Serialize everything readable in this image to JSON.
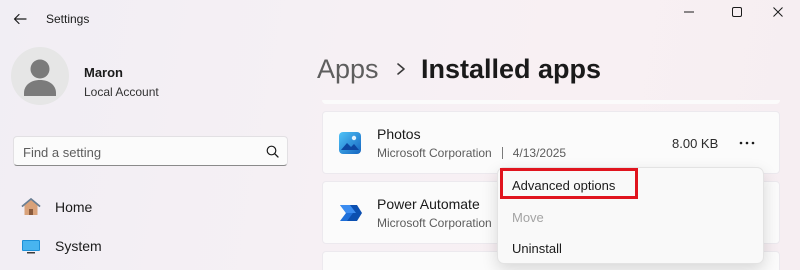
{
  "window": {
    "title": "Settings"
  },
  "profile": {
    "name": "Maron",
    "account_type": "Local Account"
  },
  "search": {
    "placeholder": "Find a setting"
  },
  "nav": {
    "items": [
      {
        "label": "Home",
        "icon": "home-icon"
      },
      {
        "label": "System",
        "icon": "system-icon"
      }
    ]
  },
  "breadcrumb": {
    "parent": "Apps",
    "current": "Installed apps"
  },
  "apps": [
    {
      "name": "Photos",
      "publisher": "Microsoft Corporation",
      "date": "4/13/2025",
      "size": "8.00 KB",
      "icon": "photos-icon"
    },
    {
      "name": "Power Automate",
      "publisher": "Microsoft Corporation",
      "icon": "power-automate-icon"
    }
  ],
  "context_menu": {
    "items": [
      {
        "label": "Advanced options",
        "enabled": true,
        "highlighted": true
      },
      {
        "label": "Move",
        "enabled": false
      },
      {
        "label": "Uninstall",
        "enabled": true
      }
    ],
    "highlight_color": "#e0141e"
  },
  "colors": {
    "accent": "#0067c0",
    "highlight_box": "#e0141e"
  }
}
